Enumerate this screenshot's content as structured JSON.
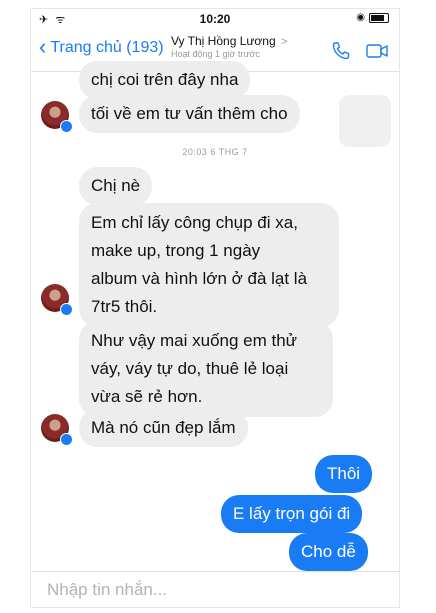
{
  "status_bar": {
    "left": "✈ ᯤ",
    "time": "10:20",
    "right": "◉"
  },
  "nav": {
    "back_label": "Trang chủ (193)",
    "contact_name": "Vy Thị Hồng Lương",
    "contact_chevron": ">",
    "contact_status": "Hoạt động 1 giờ trước",
    "phone_icon": "phone-icon",
    "video_icon": "video-camera-icon"
  },
  "colors": {
    "accent": "#1a7cf5",
    "incoming_bubble": "#ededed",
    "outgoing_bubble": "#1a7cf5"
  },
  "messages": {
    "m1": "chị coi trên đây nha",
    "m2": "tối về em tư vấn thêm cho",
    "timestamp": "20:03 6 THG 7",
    "m3": "Chị nè",
    "m4_l1": "Em chỉ lấy công chụp đi xa,",
    "m4_l2": "make up, trong 1 ngày",
    "m4_l3": "album và hình lớn ở đà lạt là",
    "m4_l4": "7tr5 thôi.",
    "m5_l1": "Như vậy mai xuống em thử",
    "m5_l2": "váy, váy tự do, thuê lẻ loại",
    "m5_l3": "vừa sẽ rẻ hơn.",
    "m6": "Mà nó cũn đẹp lắm",
    "o1": "Thôi",
    "o2": "E lấy trọn gói đi",
    "o3": "Cho dễ"
  },
  "composer": {
    "placeholder": "Nhập tin nhắn..."
  }
}
